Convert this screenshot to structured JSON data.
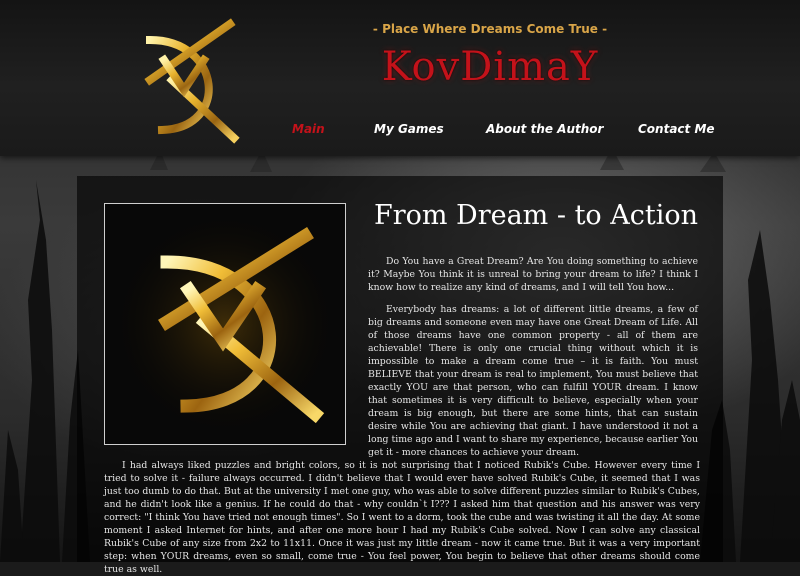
{
  "header": {
    "tagline": "- Place Where Dreams Come True -",
    "site_title": "KovDimaY"
  },
  "nav": {
    "main": "Main",
    "games": "My Games",
    "author": "About the Author",
    "contact": "Contact Me"
  },
  "content": {
    "headline": "From Dream  -  to Action",
    "paragraph1": "Do You have a Great Dream? Are You doing something to achieve it? Maybe You think it is unreal to bring your dream to life? I think I know how to realize any kind of dreams, and I will tell You how...",
    "paragraph2": "Everybody has dreams: a lot of different little dreams, a few of big dreams and someone even may have one Great Dream of Life. All of those dreams have one common property - all of them are achievable! There is only one crucial thing without which it is impossible to make a dream come true – it is faith.  You must BELIEVE that your dream is real to implement, You must believe that exactly YOU are that person, who can fulfill YOUR dream. I know that sometimes it is very difficult to believe, especially when your dream is big enough, but there are some hints, that can sustain desire  while You are achieving that giant. I have understood it not a long time ago and I want to share my experience, because earlier You get it - more chances to achieve your dream.",
    "paragraph3": "I had always liked puzzles and bright colors, so it is not surprising that I noticed Rubik's Cube. However every time I tried to solve it - failure always occurred. I didn't believe that I would ever have solved Rubik's Cube, it seemed that I was just too dumb to do that. But at the university I met one guy, who was able to solve different puzzles similar to Rubik's Cubes, and he didn't look like a genius. If he could do that - why couldn`t I??? I asked him that question and his answer was very correct: \"I think You have tried not enough times\". So I went to a dorm, took the cube and was twisting it all the day. At some moment I asked Internet for  hints, and after one more hour I had my Rubik's Cube solved. Now I can solve any classical Rubik's Cube of any size from 2x2 to 11x11. Once it was just my little dream - now it came true. But it was a very important step: when YOUR dreams, even so small, come true - You feel power, You begin to believe that other dreams should come true as well."
  },
  "colors": {
    "accent_red": "#c4121a",
    "gold": "#d9a548",
    "background": "#1b1b1b"
  },
  "icons": {
    "logo": "kdy-monogram-logo"
  }
}
